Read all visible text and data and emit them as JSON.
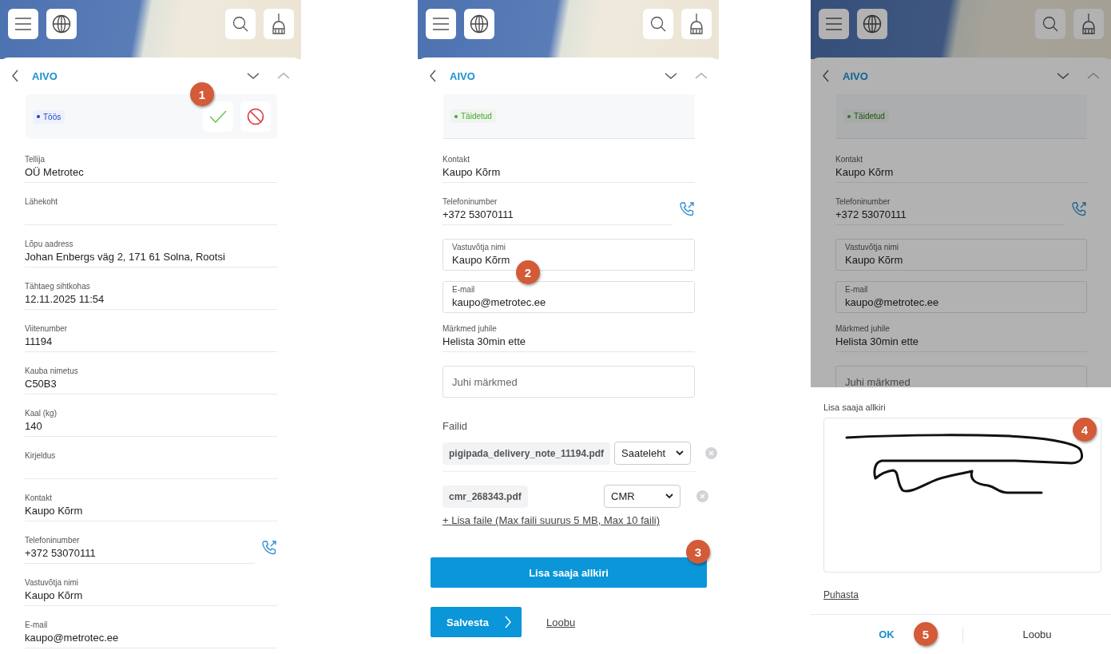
{
  "screens": [
    {
      "header": {
        "title": "AIVO"
      },
      "status": {
        "label": "Töös",
        "color": "#1f3fd1",
        "actions": true,
        "badge": "1"
      },
      "fields": [
        {
          "kind": "text",
          "label": "Tellija",
          "value": "OÜ Metrotec"
        },
        {
          "kind": "text",
          "label": "Lähekoht"
        },
        {
          "kind": "text",
          "label": "Lõpu aadress",
          "value": "Johan Enbergs väg 2, 171 61 Solna, Rootsi"
        },
        {
          "kind": "text",
          "label": "Tähtaeg sihtkohas",
          "value": "12.11.2025 11:54"
        },
        {
          "kind": "text",
          "label": "Viitenumber",
          "value": "11194"
        },
        {
          "kind": "text",
          "label": "Kauba nimetus",
          "value": "C50B3"
        },
        {
          "kind": "text",
          "label": "Kaal (kg)",
          "value": "140"
        },
        {
          "kind": "text",
          "label": "Kirjeldus"
        },
        {
          "kind": "text",
          "label": "Kontakt",
          "value": "Kaupo Kõrm"
        },
        {
          "kind": "phone",
          "label": "Telefoninumber",
          "value": "+372 53070111"
        },
        {
          "kind": "text",
          "label": "Vastuvõtja nimi",
          "value": "Kaupo Kõrm"
        },
        {
          "kind": "text",
          "label": "E-mail",
          "value": "kaupo@metrotec.ee"
        }
      ]
    },
    {
      "header": {
        "title": "AIVO"
      },
      "status": {
        "label": "Täidetud",
        "color": "#3faa2e"
      },
      "fields": [
        {
          "kind": "text",
          "label": "Kontakt",
          "value": "Kaupo Kõrm"
        },
        {
          "kind": "phone",
          "label": "Telefoninumber",
          "value": "+372 53070111"
        },
        {
          "kind": "input",
          "label": "Vastuvõtja nimi",
          "value": "Kaupo Kõrm",
          "badge": "2"
        },
        {
          "kind": "input",
          "label": "E-mail",
          "value": "kaupo@metrotec.ee"
        },
        {
          "kind": "text",
          "label": "Märkmed juhile",
          "value": "Helista 30min ette"
        },
        {
          "kind": "textarea",
          "placeholder": "Juhi märkmed"
        }
      ],
      "files": {
        "title": "Failid",
        "items": [
          {
            "name": "pigipada_delivery_note_11194.pdf",
            "type": "Saateleht"
          },
          {
            "name": "cmr_268343.pdf",
            "type": "CMR"
          }
        ],
        "add_link": "+ Lisa faile (Max faili suurus 5 MB, Max 10 faili)"
      },
      "sign_button": {
        "label": "Lisa saaja allkiri",
        "badge": "3"
      },
      "save_button": "Salvesta",
      "cancel_link": "Loobu"
    },
    {
      "header": {
        "title": "AIVO"
      },
      "status": {
        "label": "Täidetud",
        "color": "#2c7720"
      },
      "fields": [
        {
          "kind": "text",
          "label": "Kontakt",
          "value": "Kaupo Kõrm"
        },
        {
          "kind": "phone",
          "label": "Telefoninumber",
          "value": "+372 53070111"
        },
        {
          "kind": "input",
          "label": "Vastuvõtja nimi",
          "value": "Kaupo Kõrm"
        },
        {
          "kind": "input",
          "label": "E-mail",
          "value": "kaupo@metrotec.ee"
        },
        {
          "kind": "text",
          "label": "Märkmed juhile",
          "value": "Helista 30min ette"
        },
        {
          "kind": "textarea",
          "placeholder": "Juhi märkmed"
        }
      ],
      "dialog": {
        "title": "Lisa saaja allkiri",
        "badge": "4",
        "clear_link": "Puhasta",
        "ok": {
          "label": "OK",
          "badge": "5"
        },
        "cancel": "Loobu"
      }
    }
  ]
}
